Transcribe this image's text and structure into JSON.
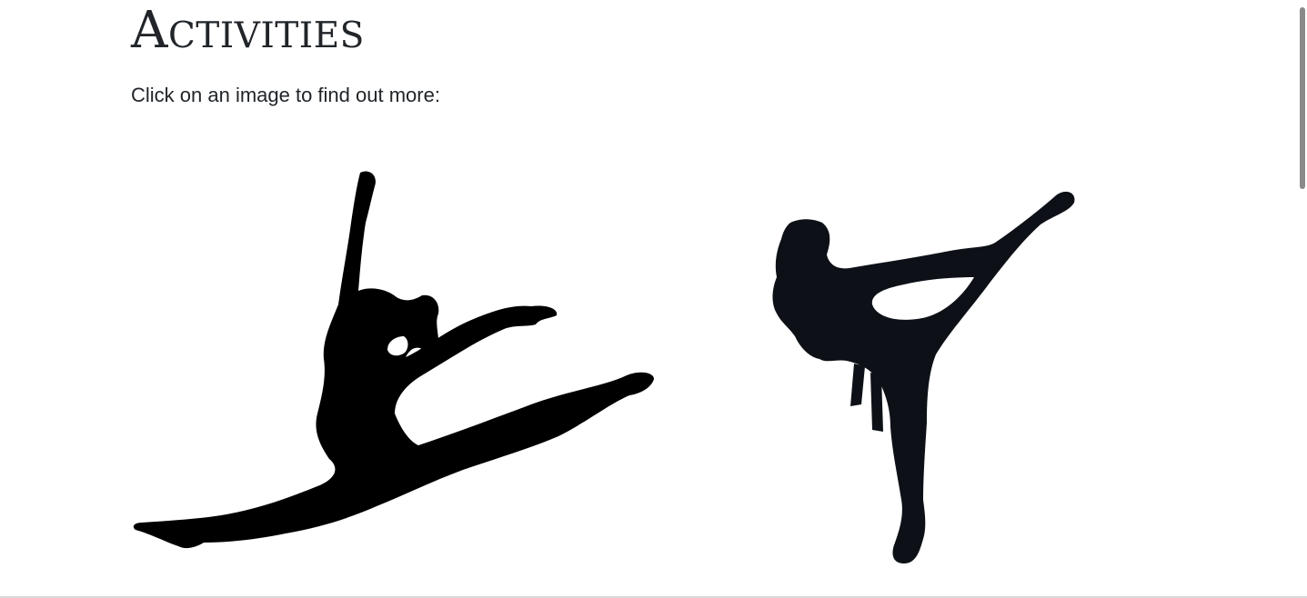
{
  "page": {
    "title": "Activities",
    "intro": "Click on an image to find out more:"
  },
  "activities": [
    {
      "name": "dance",
      "icon": "dancer-silhouette-icon",
      "color": "#000000"
    },
    {
      "name": "karate",
      "icon": "martial-artist-silhouette-icon",
      "color": "#0d1117"
    }
  ],
  "colors": {
    "text": "#212529",
    "background": "#ffffff",
    "scrollbar_thumb": "#8a8a8a"
  }
}
